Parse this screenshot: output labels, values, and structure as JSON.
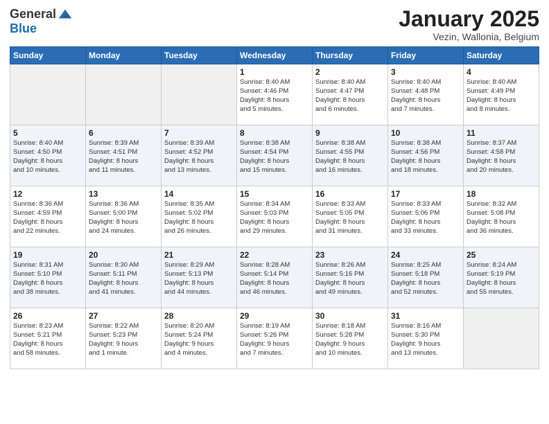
{
  "header": {
    "logo_general": "General",
    "logo_blue": "Blue",
    "month_title": "January 2025",
    "location": "Vezin, Wallonia, Belgium"
  },
  "weekdays": [
    "Sunday",
    "Monday",
    "Tuesday",
    "Wednesday",
    "Thursday",
    "Friday",
    "Saturday"
  ],
  "weeks": [
    [
      {
        "day": "",
        "info": ""
      },
      {
        "day": "",
        "info": ""
      },
      {
        "day": "",
        "info": ""
      },
      {
        "day": "1",
        "info": "Sunrise: 8:40 AM\nSunset: 4:46 PM\nDaylight: 8 hours\nand 5 minutes."
      },
      {
        "day": "2",
        "info": "Sunrise: 8:40 AM\nSunset: 4:47 PM\nDaylight: 8 hours\nand 6 minutes."
      },
      {
        "day": "3",
        "info": "Sunrise: 8:40 AM\nSunset: 4:48 PM\nDaylight: 8 hours\nand 7 minutes."
      },
      {
        "day": "4",
        "info": "Sunrise: 8:40 AM\nSunset: 4:49 PM\nDaylight: 8 hours\nand 8 minutes."
      }
    ],
    [
      {
        "day": "5",
        "info": "Sunrise: 8:40 AM\nSunset: 4:50 PM\nDaylight: 8 hours\nand 10 minutes."
      },
      {
        "day": "6",
        "info": "Sunrise: 8:39 AM\nSunset: 4:51 PM\nDaylight: 8 hours\nand 11 minutes."
      },
      {
        "day": "7",
        "info": "Sunrise: 8:39 AM\nSunset: 4:52 PM\nDaylight: 8 hours\nand 13 minutes."
      },
      {
        "day": "8",
        "info": "Sunrise: 8:38 AM\nSunset: 4:54 PM\nDaylight: 8 hours\nand 15 minutes."
      },
      {
        "day": "9",
        "info": "Sunrise: 8:38 AM\nSunset: 4:55 PM\nDaylight: 8 hours\nand 16 minutes."
      },
      {
        "day": "10",
        "info": "Sunrise: 8:38 AM\nSunset: 4:56 PM\nDaylight: 8 hours\nand 18 minutes."
      },
      {
        "day": "11",
        "info": "Sunrise: 8:37 AM\nSunset: 4:58 PM\nDaylight: 8 hours\nand 20 minutes."
      }
    ],
    [
      {
        "day": "12",
        "info": "Sunrise: 8:36 AM\nSunset: 4:59 PM\nDaylight: 8 hours\nand 22 minutes."
      },
      {
        "day": "13",
        "info": "Sunrise: 8:36 AM\nSunset: 5:00 PM\nDaylight: 8 hours\nand 24 minutes."
      },
      {
        "day": "14",
        "info": "Sunrise: 8:35 AM\nSunset: 5:02 PM\nDaylight: 8 hours\nand 26 minutes."
      },
      {
        "day": "15",
        "info": "Sunrise: 8:34 AM\nSunset: 5:03 PM\nDaylight: 8 hours\nand 29 minutes."
      },
      {
        "day": "16",
        "info": "Sunrise: 8:33 AM\nSunset: 5:05 PM\nDaylight: 8 hours\nand 31 minutes."
      },
      {
        "day": "17",
        "info": "Sunrise: 8:33 AM\nSunset: 5:06 PM\nDaylight: 8 hours\nand 33 minutes."
      },
      {
        "day": "18",
        "info": "Sunrise: 8:32 AM\nSunset: 5:08 PM\nDaylight: 8 hours\nand 36 minutes."
      }
    ],
    [
      {
        "day": "19",
        "info": "Sunrise: 8:31 AM\nSunset: 5:10 PM\nDaylight: 8 hours\nand 38 minutes."
      },
      {
        "day": "20",
        "info": "Sunrise: 8:30 AM\nSunset: 5:11 PM\nDaylight: 8 hours\nand 41 minutes."
      },
      {
        "day": "21",
        "info": "Sunrise: 8:29 AM\nSunset: 5:13 PM\nDaylight: 8 hours\nand 44 minutes."
      },
      {
        "day": "22",
        "info": "Sunrise: 8:28 AM\nSunset: 5:14 PM\nDaylight: 8 hours\nand 46 minutes."
      },
      {
        "day": "23",
        "info": "Sunrise: 8:26 AM\nSunset: 5:16 PM\nDaylight: 8 hours\nand 49 minutes."
      },
      {
        "day": "24",
        "info": "Sunrise: 8:25 AM\nSunset: 5:18 PM\nDaylight: 8 hours\nand 52 minutes."
      },
      {
        "day": "25",
        "info": "Sunrise: 8:24 AM\nSunset: 5:19 PM\nDaylight: 8 hours\nand 55 minutes."
      }
    ],
    [
      {
        "day": "26",
        "info": "Sunrise: 8:23 AM\nSunset: 5:21 PM\nDaylight: 8 hours\nand 58 minutes."
      },
      {
        "day": "27",
        "info": "Sunrise: 8:22 AM\nSunset: 5:23 PM\nDaylight: 9 hours\nand 1 minute."
      },
      {
        "day": "28",
        "info": "Sunrise: 8:20 AM\nSunset: 5:24 PM\nDaylight: 9 hours\nand 4 minutes."
      },
      {
        "day": "29",
        "info": "Sunrise: 8:19 AM\nSunset: 5:26 PM\nDaylight: 9 hours\nand 7 minutes."
      },
      {
        "day": "30",
        "info": "Sunrise: 8:18 AM\nSunset: 5:28 PM\nDaylight: 9 hours\nand 10 minutes."
      },
      {
        "day": "31",
        "info": "Sunrise: 8:16 AM\nSunset: 5:30 PM\nDaylight: 9 hours\nand 13 minutes."
      },
      {
        "day": "",
        "info": ""
      }
    ]
  ]
}
